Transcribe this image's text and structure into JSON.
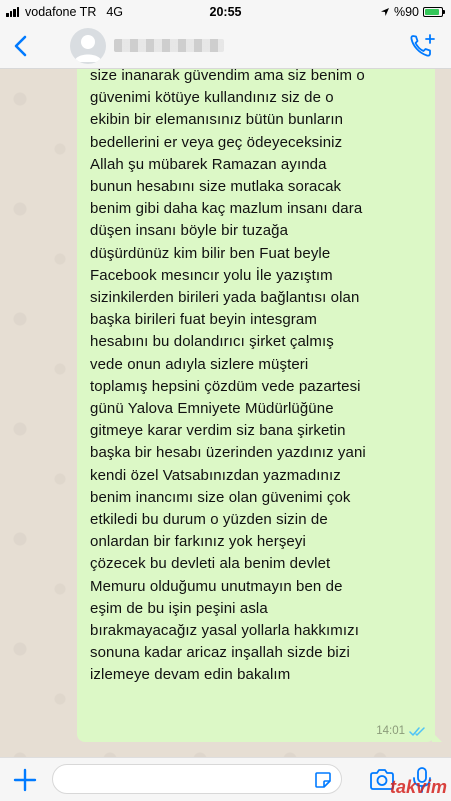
{
  "status_bar": {
    "carrier": "vodafone TR",
    "network": "4G",
    "time": "20:55",
    "battery_percent": "%90",
    "battery_level": 0.9
  },
  "header": {
    "contact_name": "",
    "icons": {
      "back": "chevron-left-icon",
      "avatar": "avatar",
      "call": "add-call-icon"
    }
  },
  "message": {
    "direction": "outgoing",
    "lines": [
      "size inanarak güvendim ama siz benim o",
      "güvenimi kötüye kullandınız siz de o",
      "ekibin bir elemanısınız bütün bunların",
      "bedellerini er veya geç ödeyeceksiniz",
      "Allah şu mübarek Ramazan ayında",
      "bunun hesabını size mutlaka soracak",
      "benim gibi daha kaç mazlum insanı dara",
      "düşen insanı böyle bir tuzağa",
      "düşürdünüz kim bilir ben Fuat beyle",
      "Facebook mesıncır yolu İle yazıştım",
      "sizinkilerden birileri yada bağlantısı olan",
      "başka birileri fuat beyin intesgram",
      "hesabını bu dolandırıcı şirket çalmış",
      "vede onun adıyla sizlere müşteri",
      "toplamış hepsini çözdüm vede pazartesi",
      "günü Yalova Emniyete Müdürlüğüne",
      "gitmeye karar verdim siz bana şirketin",
      "başka bir hesabı üzerinden yazdınız yani",
      "kendi özel Vatsabınızdan yazmadınız",
      "benim inancımı size olan güvenimi çok",
      "etkiledi bu durum o yüzden sizin de",
      "onlardan bir farkınız yok herşeyi",
      "çözecek bu devleti ala benim devlet",
      "Memuru olduğumu unutmayın ben de",
      "eşim de bu işin peşini asla",
      "bırakmayacağız yasal yollarla hakkımızı",
      "sonuna kadar aricaz inşallah sizde bizi",
      "izlemeye devam edin bakalım"
    ],
    "time": "14:01",
    "status_icon": "double-check-read-icon"
  },
  "input_bar": {
    "placeholder": "",
    "icons": {
      "add": "plus-icon",
      "sticker": "sticker-icon",
      "camera": "camera-icon",
      "mic": "microphone-icon"
    },
    "watermark": "takvim"
  },
  "colors": {
    "accent": "#007aff",
    "bubble": "#dcf8c6",
    "read_ticks": "#4fc3f7",
    "battery": "#34c759"
  }
}
